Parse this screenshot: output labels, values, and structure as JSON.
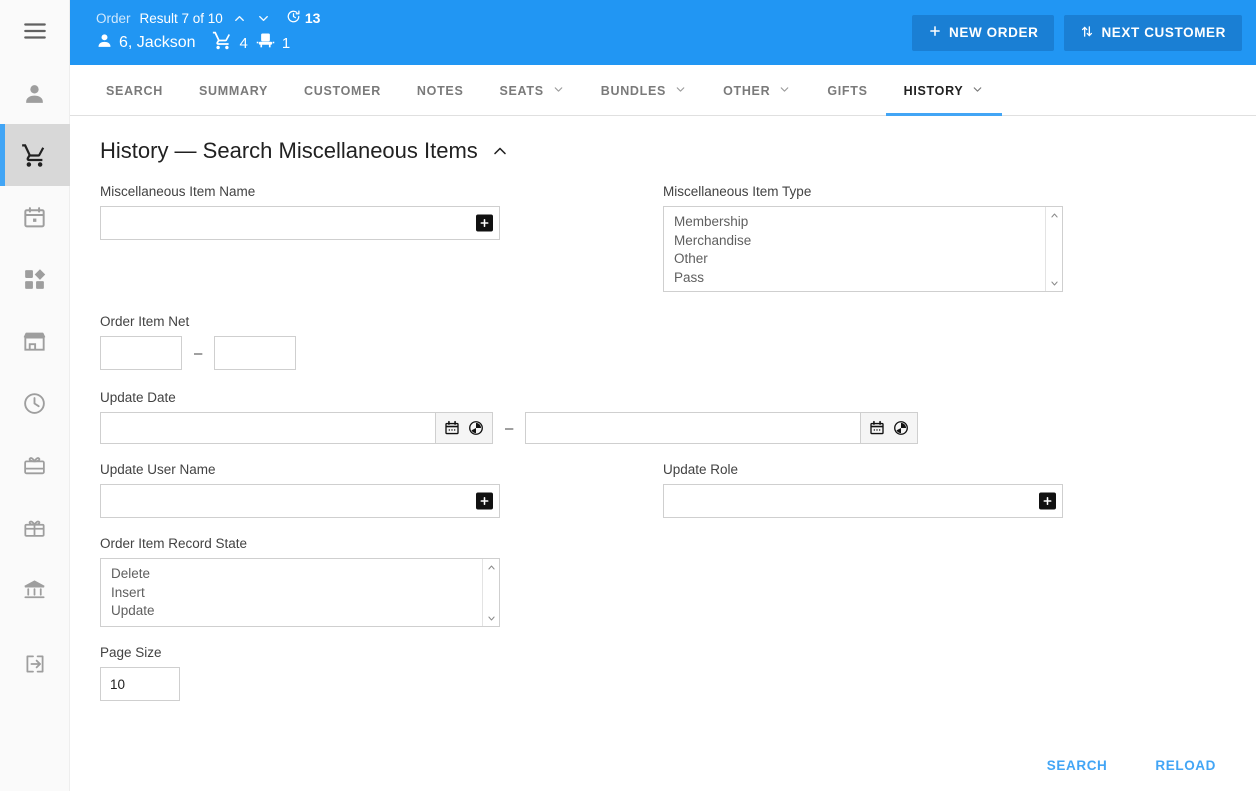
{
  "sidebar": {
    "items": [
      {
        "name": "menu",
        "icon": "hamburger-menu-icon",
        "active": false
      },
      {
        "name": "customer",
        "icon": "person-icon",
        "active": false
      },
      {
        "name": "orders",
        "icon": "shopping-cart-icon",
        "active": true
      },
      {
        "name": "calendar",
        "icon": "calendar-icon",
        "active": false
      },
      {
        "name": "dashboard",
        "icon": "dashboard-shapes-icon",
        "active": false
      },
      {
        "name": "store",
        "icon": "storefront-icon",
        "active": false
      },
      {
        "name": "history",
        "icon": "clock-icon",
        "active": false
      },
      {
        "name": "gift-card",
        "icon": "gift-card-icon",
        "active": false
      },
      {
        "name": "gifts",
        "icon": "gift-box-icon",
        "active": false
      },
      {
        "name": "accounts",
        "icon": "bank-icon",
        "active": false
      },
      {
        "name": "logout",
        "icon": "exit-arrow-icon",
        "active": false
      }
    ]
  },
  "topbar": {
    "entity_label": "Order",
    "result_label": "Result 7 of 10",
    "timer_value": "13",
    "customer_name": "6, Jackson",
    "cart_count": "4",
    "seat_count": "1",
    "new_order_label": "NEW ORDER",
    "next_customer_label": "NEXT CUSTOMER",
    "accent_color": "#2196f3",
    "button_color": "#1a7fd4"
  },
  "tabs": [
    {
      "label": "SEARCH",
      "has_chevron": false,
      "active": false
    },
    {
      "label": "SUMMARY",
      "has_chevron": false,
      "active": false
    },
    {
      "label": "CUSTOMER",
      "has_chevron": false,
      "active": false
    },
    {
      "label": "NOTES",
      "has_chevron": false,
      "active": false
    },
    {
      "label": "SEATS",
      "has_chevron": true,
      "active": false
    },
    {
      "label": "BUNDLES",
      "has_chevron": true,
      "active": false
    },
    {
      "label": "OTHER",
      "has_chevron": true,
      "active": false
    },
    {
      "label": "GIFTS",
      "has_chevron": false,
      "active": false
    },
    {
      "label": "HISTORY",
      "has_chevron": true,
      "active": true
    }
  ],
  "form": {
    "title": "History — Search Miscellaneous Items",
    "misc_item_name": {
      "label": "Miscellaneous Item Name",
      "value": "",
      "placeholder": ""
    },
    "misc_item_type": {
      "label": "Miscellaneous Item Type",
      "options": [
        "Membership",
        "Merchandise",
        "Other",
        "Pass"
      ]
    },
    "order_item_net": {
      "label": "Order Item Net",
      "from": "",
      "to": "",
      "separator": "–"
    },
    "update_date": {
      "label": "Update Date",
      "from": "",
      "to": "",
      "separator": "–"
    },
    "update_user_name": {
      "label": "Update User Name",
      "value": ""
    },
    "update_role": {
      "label": "Update Role",
      "value": ""
    },
    "order_item_record_state": {
      "label": "Order Item Record State",
      "options": [
        "Delete",
        "Insert",
        "Update"
      ]
    },
    "page_size": {
      "label": "Page Size",
      "value": "10"
    }
  },
  "actions": {
    "search_label": "SEARCH",
    "reload_label": "RELOAD",
    "link_color": "#42a5f5"
  }
}
